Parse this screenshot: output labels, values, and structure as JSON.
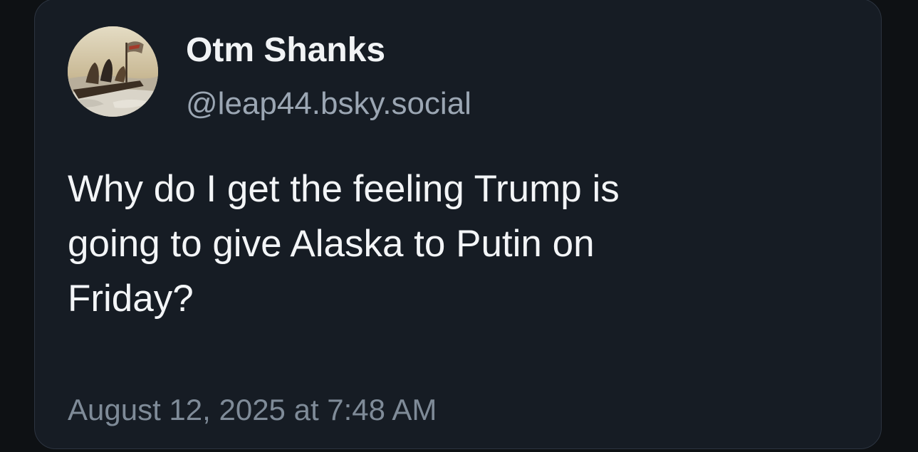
{
  "post": {
    "author": {
      "display_name": "Otm Shanks",
      "handle": "@leap44.bsky.social",
      "avatar_icon": "painting-avatar-icon"
    },
    "text": "Why do I get the feeling Trump is\ngoing to give Alaska to Putin on\nFriday?",
    "timestamp": "August 12, 2025 at 7:48 AM"
  },
  "colors": {
    "card_background": "#161c24",
    "page_background": "#0e1114",
    "name_text": "#f1f3f5",
    "handle_text": "#9ba6b3",
    "timestamp_text": "#7f8b98"
  }
}
